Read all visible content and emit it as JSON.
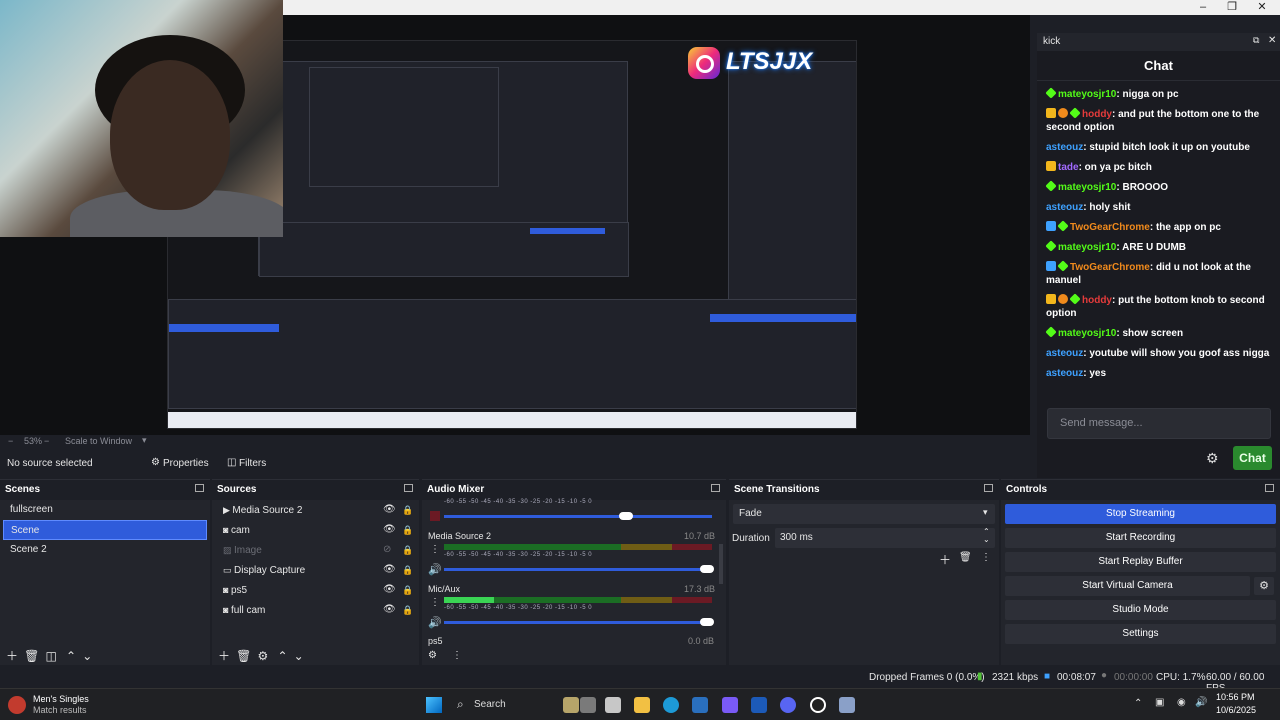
{
  "window": {
    "minimize_glyph": "–",
    "restore_glyph": "❐",
    "close_glyph": "✕"
  },
  "preview": {
    "logo_text": "LTSJJX",
    "zoom_label": "53%",
    "zoom_mode": "Scale to Window"
  },
  "chat": {
    "dock_title": "kick",
    "title": "Chat",
    "messages": [
      {
        "badges": [
          "green"
        ],
        "user": "mateyosjr10",
        "user_color": "#53fc18",
        "text": "nigga on pc"
      },
      {
        "badges": [
          "crown",
          "orange",
          "green"
        ],
        "user": "hoddy",
        "user_color": "#e53b3b",
        "text": "and put the bottom one to the second option"
      },
      {
        "badges": [],
        "user": "asteouz",
        "user_color": "#3ea1ff",
        "text": "stupid bitch look it up on youtube"
      },
      {
        "badges": [
          "crown"
        ],
        "user": "tade",
        "user_color": "#a26bff",
        "text": "on ya pc bitch"
      },
      {
        "badges": [
          "green"
        ],
        "user": "mateyosjr10",
        "user_color": "#53fc18",
        "text": "BROOOO"
      },
      {
        "badges": [],
        "user": "asteouz",
        "user_color": "#3ea1ff",
        "text": "holy shit"
      },
      {
        "badges": [
          "blue",
          "green"
        ],
        "user": "TwoGearChrome",
        "user_color": "#f08a1c",
        "text": "the app on pc"
      },
      {
        "badges": [
          "green"
        ],
        "user": "mateyosjr10",
        "user_color": "#53fc18",
        "text": "ARE U DUMB"
      },
      {
        "badges": [
          "blue",
          "green"
        ],
        "user": "TwoGearChrome",
        "user_color": "#f08a1c",
        "text": "did u not look at the manuel"
      },
      {
        "badges": [
          "crown",
          "orange",
          "green"
        ],
        "user": "hoddy",
        "user_color": "#e53b3b",
        "text": "put the bottom knob to second option"
      },
      {
        "badges": [
          "green"
        ],
        "user": "mateyosjr10",
        "user_color": "#53fc18",
        "text": "show screen"
      },
      {
        "badges": [],
        "user": "asteouz",
        "user_color": "#3ea1ff",
        "text": "youtube will show you goof ass nigga"
      },
      {
        "badges": [],
        "user": "asteouz",
        "user_color": "#3ea1ff",
        "text": "yes"
      }
    ],
    "input_placeholder": "Send message...",
    "send_label": "Chat"
  },
  "source_bar": {
    "status": "No source selected",
    "properties_label": "Properties",
    "filters_label": "Filters"
  },
  "scenes": {
    "title": "Scenes",
    "items": [
      "fullscreen",
      "Scene",
      "Scene 2"
    ],
    "selected_index": 1
  },
  "sources": {
    "title": "Sources",
    "items": [
      {
        "label": "Media Source 2",
        "icon": "play-icon",
        "visible": true
      },
      {
        "label": "cam",
        "icon": "camera-icon",
        "visible": true
      },
      {
        "label": "Image",
        "icon": "image-icon",
        "visible": false
      },
      {
        "label": "Display Capture",
        "icon": "monitor-icon",
        "visible": true
      },
      {
        "label": "ps5",
        "icon": "camera-icon",
        "visible": true
      },
      {
        "label": "full cam",
        "icon": "camera-icon",
        "visible": true
      }
    ]
  },
  "audio_mixer": {
    "title": "Audio Mixer",
    "ticks": [
      "-60",
      "-55",
      "-50",
      "-45",
      "-40",
      "-35",
      "-30",
      "-25",
      "-20",
      "-15",
      "-10",
      "-5",
      "0"
    ],
    "channels": [
      {
        "name": "",
        "db": "",
        "volume": 0.68
      },
      {
        "name": "Media Source 2",
        "db": "10.7 dB",
        "volume": 0.98
      },
      {
        "name": "Mic/Aux",
        "db": "17.3 dB",
        "volume": 0.98
      },
      {
        "name": "ps5",
        "db": "0.0 dB"
      }
    ]
  },
  "transitions": {
    "title": "Scene Transitions",
    "selected": "Fade",
    "duration_label": "Duration",
    "duration_value": "300 ms"
  },
  "controls": {
    "title": "Controls",
    "buttons": [
      "Stop Streaming",
      "Start Recording",
      "Start Replay Buffer",
      "Start Virtual Camera",
      "Studio Mode",
      "Settings"
    ]
  },
  "status": {
    "dropped_frames": "Dropped Frames 0 (0.0%)",
    "bitrate": "2321 kbps",
    "stream_time": "00:08:07",
    "record_time": "00:00:00",
    "cpu": "CPU: 1.7%",
    "fps": "60.00 / 60.00 FPS"
  },
  "taskbar": {
    "notification_title": "Men's Singles",
    "notification_sub": "Match results",
    "search_placeholder": "Search",
    "time": "10:56 PM",
    "date": "10/6/2025"
  },
  "colors": {
    "accent": "#2f5cdb",
    "kick_green": "#53fc18"
  }
}
